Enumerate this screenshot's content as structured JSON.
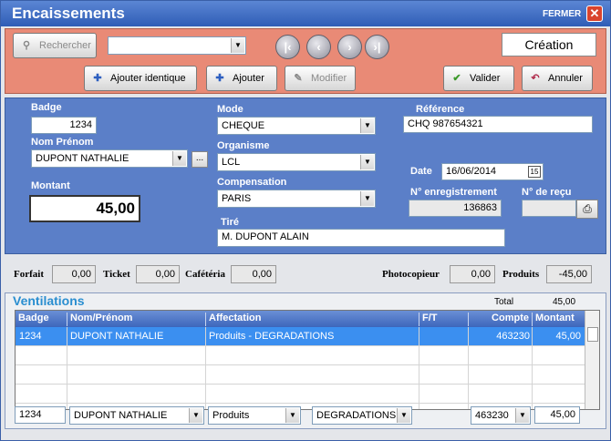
{
  "window": {
    "title": "Encaissements",
    "close_label": "FERMER",
    "close_glyph": "✕"
  },
  "toolbar": {
    "search_label": "Rechercher",
    "search_combo_value": "",
    "status": "Création",
    "add_identical_label": "Ajouter identique",
    "add_label": "Ajouter",
    "modify_label": "Modifier",
    "validate_label": "Valider",
    "cancel_label": "Annuler",
    "nav": {
      "first": "|‹",
      "prev": "‹",
      "next": "›",
      "last": "›|"
    }
  },
  "form": {
    "badge_label": "Badge",
    "badge": "1234",
    "name_label": "Nom Prénom",
    "name": "DUPONT NATHALIE",
    "browse": "...",
    "amount_label": "Montant",
    "amount": "45,00",
    "mode_label": "Mode",
    "mode": "CHEQUE",
    "organism_label": "Organisme",
    "organism": "LCL",
    "compensation_label": "Compensation",
    "compensation": "PARIS",
    "drawer_label": "Tiré",
    "drawer": "M. DUPONT ALAIN",
    "reference_label": "Référence",
    "reference": "CHQ 987654321",
    "date_label": "Date",
    "date": "16/06/2014",
    "date_icon": "15",
    "registration_label": "N° enregistrement",
    "registration": "136863",
    "receipt_label": "N° de reçu",
    "receipt": ""
  },
  "totals": {
    "forfait_label": "Forfait",
    "forfait": "0,00",
    "ticket_label": "Ticket",
    "ticket": "0,00",
    "cafeteria_label": "Cafétéria",
    "cafeteria": "0,00",
    "photocopier_label": "Photocopieur",
    "photocopier": "0,00",
    "products_label": "Produits",
    "products": "-45,00"
  },
  "ventilations": {
    "title": "Ventilations",
    "total_label": "Total",
    "total": "45,00",
    "columns": [
      "Badge",
      "Nom/Prénom",
      "Affectation",
      "F/T",
      "Compte",
      "Montant"
    ],
    "rows": [
      {
        "badge": "1234",
        "name": "DUPONT NATHALIE",
        "affectation": "Produits - DEGRADATIONS",
        "ft": "",
        "account": "463230",
        "amount": "45,00"
      }
    ],
    "edit": {
      "badge": "1234",
      "name": "DUPONT NATHALIE",
      "category": "Produits",
      "subcategory": "DEGRADATIONS",
      "account": "463230",
      "amount": "45,00"
    }
  },
  "colors": {
    "titlebar": "#2f5db6",
    "toolbar": "#e98a76",
    "form": "#5b7fc8",
    "selection": "#3b8ff0",
    "accent_title": "#2a8ed0"
  }
}
